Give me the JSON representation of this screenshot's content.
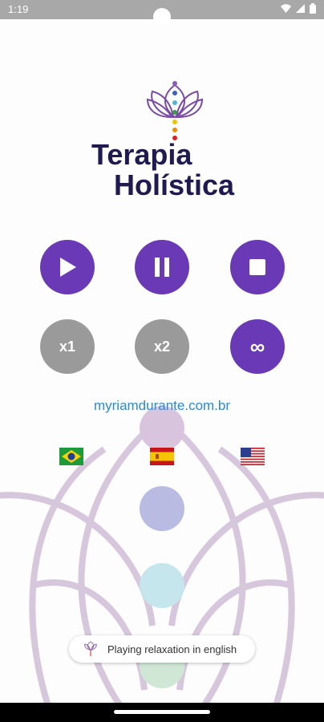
{
  "status_bar": {
    "time": "1:19",
    "icons": [
      "wifi-icon",
      "signal-icon",
      "battery-icon"
    ]
  },
  "logo": {
    "line1": "Terapia",
    "line2": "Holística"
  },
  "controls": {
    "play": {
      "icon": "play-icon"
    },
    "pause": {
      "icon": "pause-icon"
    },
    "stop": {
      "icon": "stop-icon"
    },
    "x1_label": "x1",
    "x2_label": "x2",
    "infinite_label": "∞"
  },
  "website": "myriamdurante.com.br",
  "languages": [
    {
      "flag": "brazil-flag-icon"
    },
    {
      "flag": "spain-flag-icon"
    },
    {
      "flag": "usa-flag-icon"
    }
  ],
  "toast": {
    "text": "Playing relaxation in english"
  },
  "colors": {
    "accent": "#6a3ab6",
    "inactive": "#9a9a9a",
    "logo_text": "#1f1a4f",
    "link": "#2a8ad6"
  }
}
